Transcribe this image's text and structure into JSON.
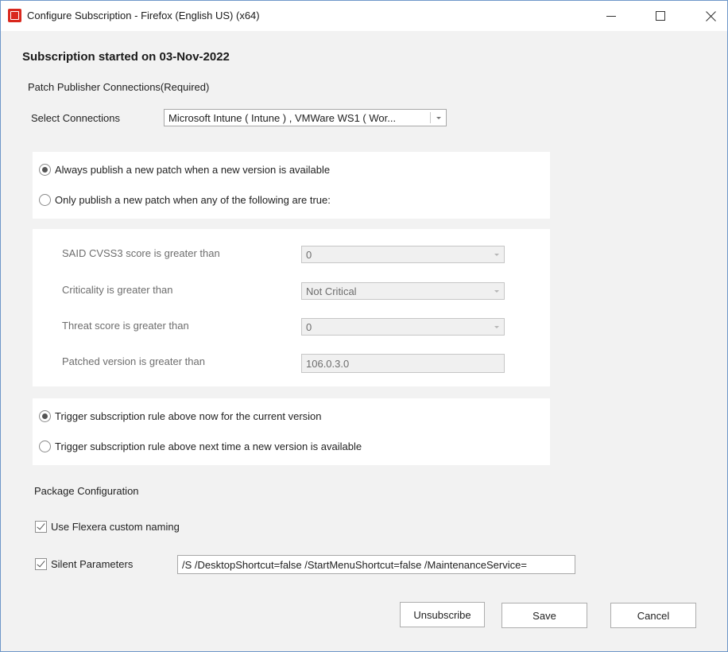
{
  "window": {
    "title": "Configure Subscription - Firefox (English US) (x64)"
  },
  "heading": "Subscription started on 03-Nov-2022",
  "connections": {
    "section_label": "Patch Publisher Connections(Required)",
    "select_label": "Select Connections",
    "selected_value": "Microsoft Intune ( Intune ) , VMWare WS1 ( Wor..."
  },
  "publish_mode": {
    "option_always": "Always publish a new patch when a new version is available",
    "option_conditional": "Only publish a new patch when any of the following are true:",
    "selected": "always"
  },
  "conditions": {
    "cvss_label": "SAID CVSS3 score is greater than",
    "cvss_value": "0",
    "criticality_label": "Criticality is greater than",
    "criticality_value": "Not Critical",
    "threat_label": "Threat score is greater than",
    "threat_value": "0",
    "version_label": "Patched version is greater than",
    "version_value": "106.0.3.0"
  },
  "trigger": {
    "option_now": "Trigger subscription rule above now for the current version",
    "option_next": "Trigger subscription rule above next time a new version is available",
    "selected": "now"
  },
  "package": {
    "section_label": "Package Configuration",
    "custom_naming_label": "Use Flexera custom naming",
    "custom_naming_checked": true,
    "silent_params_label": "Silent Parameters",
    "silent_params_checked": true,
    "silent_params_value": "/S /DesktopShortcut=false /StartMenuShortcut=false /MaintenanceService="
  },
  "buttons": {
    "unsubscribe": "Unsubscribe",
    "save": "Save",
    "cancel": "Cancel"
  }
}
